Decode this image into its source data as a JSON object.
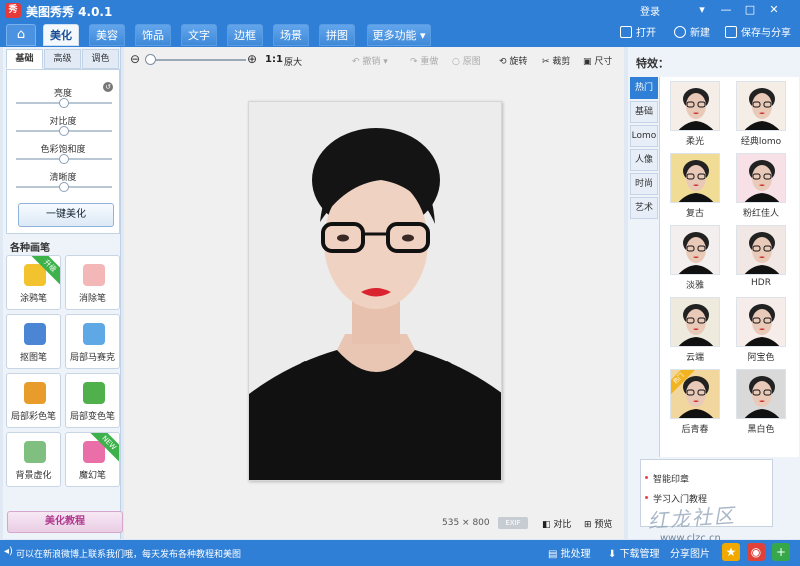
{
  "titlebar": {
    "logo": "秀",
    "title": "美图秀秀 4.0.1",
    "login": "登录"
  },
  "tabs": {
    "home": "⌂",
    "items": [
      {
        "label": "美化"
      },
      {
        "label": "美容"
      },
      {
        "label": "饰品"
      },
      {
        "label": "文字"
      },
      {
        "label": "边框"
      },
      {
        "label": "场景"
      },
      {
        "label": "拼图"
      }
    ],
    "more": "更多功能 ▾",
    "actions": {
      "open": "打开",
      "new": "新建",
      "save": "保存与分享"
    }
  },
  "left": {
    "tabs": [
      "基础",
      "高级",
      "调色"
    ],
    "sliders": [
      {
        "label": "亮度",
        "level": 0.5
      },
      {
        "label": "对比度",
        "level": 0.5
      },
      {
        "label": "色彩饱和度",
        "level": 0.5
      },
      {
        "label": "清晰度",
        "level": 0.5
      }
    ],
    "one_click": "一键美化",
    "brush_title": "各种画笔",
    "brushes": [
      {
        "label": "涂鸦笔",
        "badge": "升级",
        "color": "#f2c32e"
      },
      {
        "label": "消除笔",
        "badge": "",
        "color": "#f3b7b7"
      },
      {
        "label": "抠图笔",
        "badge": "",
        "color": "#4a86d4"
      },
      {
        "label": "局部马赛克",
        "badge": "",
        "color": "#5fa8e6"
      },
      {
        "label": "局部彩色笔",
        "badge": "",
        "color": "#e79c2b"
      },
      {
        "label": "局部变色笔",
        "badge": "",
        "color": "#4fb04c"
      },
      {
        "label": "背景虚化",
        "badge": "",
        "color": "#7fbf7f"
      },
      {
        "label": "魔幻笔",
        "badge": "NEW",
        "color": "#ea6fa8"
      }
    ],
    "tutorial": "美化教程"
  },
  "canvas": {
    "zoom_level": 0.0,
    "ratio": "1:1",
    "original_size": "原大",
    "tools": {
      "undo": "撤销",
      "redo": "重做",
      "reset": "原图",
      "rotate": "旋转",
      "crop": "裁剪",
      "resize": "尺寸"
    },
    "image_size": "535 × 800",
    "exif": "EXIF",
    "compare": "对比",
    "preview": "预览"
  },
  "effects": {
    "title": "特效：",
    "categories": [
      "热门",
      "基础",
      "Lomo",
      "人像",
      "时尚",
      "艺术"
    ],
    "items": [
      {
        "label": "柔光",
        "tint": "#f4ede8"
      },
      {
        "label": "经典lomo",
        "tint": "#f5eee6"
      },
      {
        "label": "复古",
        "tint": "#f0dc95"
      },
      {
        "label": "粉红佳人",
        "tint": "#f7e1e6"
      },
      {
        "label": "淡雅",
        "tint": "#f3efef"
      },
      {
        "label": "HDR",
        "tint": "#f1e7e5"
      },
      {
        "label": "云端",
        "tint": "#efeade"
      },
      {
        "label": "阿宝色",
        "tint": "#f6ece9"
      },
      {
        "label": "后青春",
        "tint": "#f1d79d",
        "hot": "热门"
      },
      {
        "label": "黑白色",
        "tint": "#d9d9d9"
      }
    ],
    "recommend": [
      "智能印章",
      "学习入门教程"
    ]
  },
  "watermark": {
    "text": "红龙社区",
    "sub": "www.clzc.cn"
  },
  "status": {
    "text": "可以在新浪微博上联系我们哦，每天发布各种教程和美图",
    "batch": "批处理",
    "download": "下载管理",
    "share": "分享图片"
  }
}
